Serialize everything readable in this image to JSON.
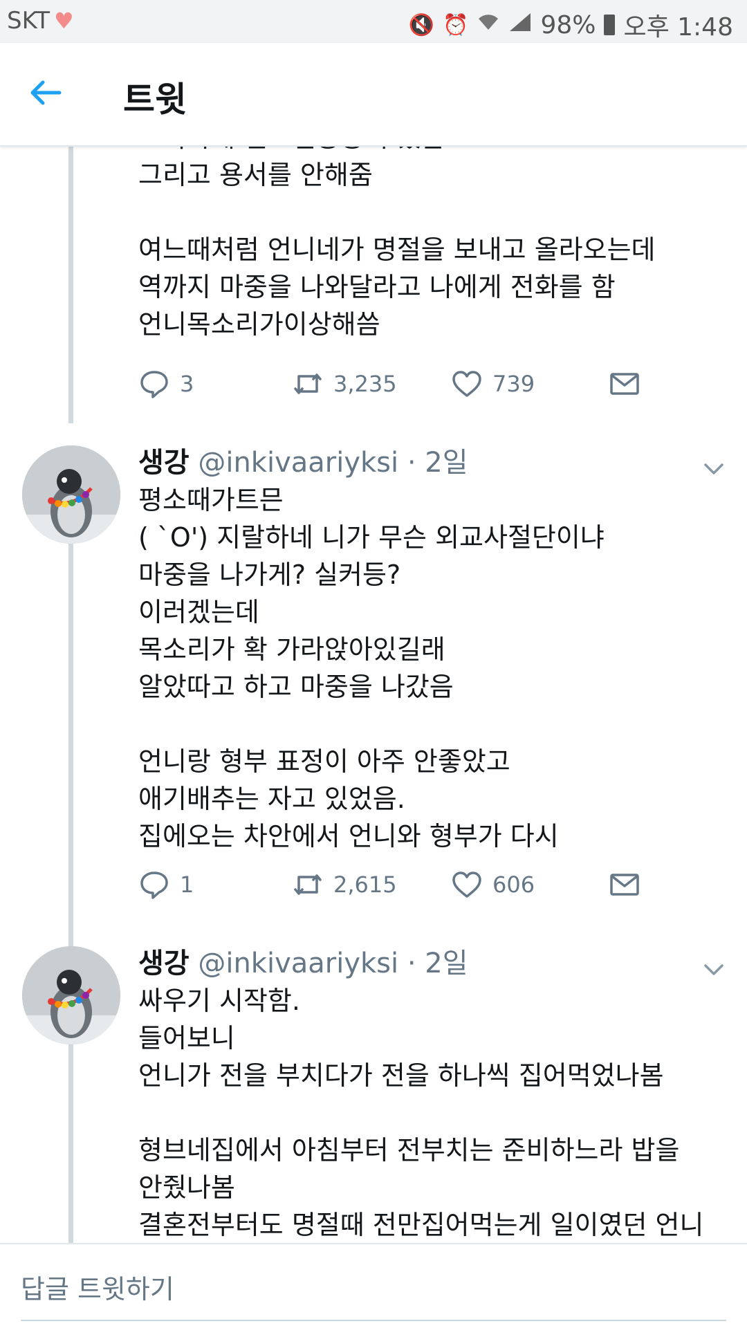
{
  "status_bar": {
    "carrier": "SKT",
    "battery": "98%",
    "time": "오후 1:48"
  },
  "header": {
    "title": "트윗"
  },
  "tweets": [
    {
      "text": "오묵하게 일으킨공공이 있음.\n그리고 용서를 안해줌\n\n여느때처럼 언니네가 명절을 보내고 올라오는데\n역까지 마중을 나와달라고 나에게 전화를 함\n언니목소리가이상해씀",
      "replies": "3",
      "retweets": "3,235",
      "likes": "739"
    },
    {
      "name": "생강",
      "handle": "@inkivaariyksi",
      "dot": "·",
      "time": "2일",
      "text": "평소때가트믄\n( `O') 지랄하네 니가 무슨 외교사절단이냐\n마중을 나가게? 실커등?\n이러겠는데\n목소리가 확 가라앉아있길래\n알았따고 하고 마중을 나갔음\n\n언니랑 형부 표정이 아주 안좋았고\n애기배추는 자고 있었음.\n집에오는 차안에서 언니와 형부가 다시",
      "replies": "1",
      "retweets": "2,615",
      "likes": "606"
    },
    {
      "name": "생강",
      "handle": "@inkivaariyksi",
      "dot": "·",
      "time": "2일",
      "text": "싸우기 시작함.\n들어보니\n언니가 전을 부치다가 전을 하나씩 집어먹었나봄\n\n형브네집에서 아침부터 전부치는 준비하느라 밥을\n안줬나봄\n결혼전부터도 명절때  전만집어먹는게 일이였던 언니가"
    }
  ],
  "reply_bar": {
    "placeholder": "답글 트윗하기"
  },
  "colors": {
    "accent": "#1da1f2",
    "muted": "#657786",
    "thread_line": "#cfd9de"
  }
}
